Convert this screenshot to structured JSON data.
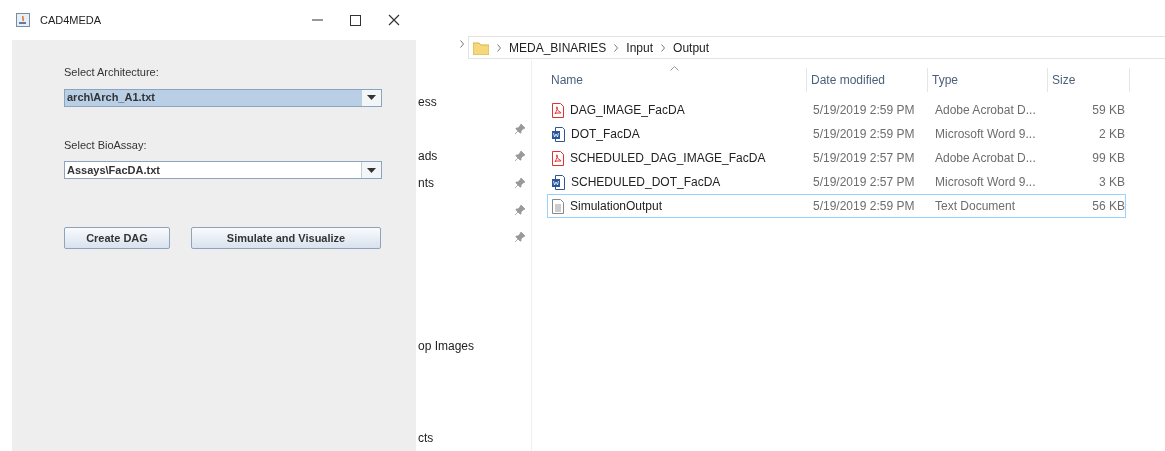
{
  "java_window": {
    "title": "CAD4MEDA",
    "fields": [
      {
        "label": "Select Architecture:",
        "value": "arch\\Arch_A1.txt",
        "focused": true
      },
      {
        "label": "Select BioAssay:",
        "value": "Assays\\FacDA.txt",
        "focused": false
      }
    ],
    "buttons": [
      "Create DAG",
      "Simulate and Visualize"
    ]
  },
  "explorer": {
    "breadcrumb": [
      "MEDA_BINARIES",
      "Input",
      "Output"
    ],
    "nav_items": [
      {
        "label": "ess",
        "pinned": false
      },
      {
        "pinned": true
      },
      {
        "label": "ads",
        "pinned": true
      },
      {
        "label": "nts",
        "pinned": true
      },
      {
        "pinned": true
      },
      {
        "pinned": true
      }
    ],
    "nav_lower": [
      "op Images",
      "cts"
    ],
    "columns": [
      "Name",
      "Date modified",
      "Type",
      "Size"
    ],
    "files": [
      {
        "kind": "pdf",
        "name": "DAG_IMAGE_FacDA",
        "date": "5/19/2019 2:59 PM",
        "type": "Adobe Acrobat D...",
        "size": "59 KB",
        "selected": false
      },
      {
        "kind": "word",
        "name": "DOT_FacDA",
        "date": "5/19/2019 2:59 PM",
        "type": "Microsoft Word 9...",
        "size": "2 KB",
        "selected": false
      },
      {
        "kind": "pdf",
        "name": "SCHEDULED_DAG_IMAGE_FacDA",
        "date": "5/19/2019 2:57 PM",
        "type": "Adobe Acrobat D...",
        "size": "99 KB",
        "selected": false
      },
      {
        "kind": "word",
        "name": "SCHEDULED_DOT_FacDA",
        "date": "5/19/2019 2:57 PM",
        "type": "Microsoft Word 9...",
        "size": "3 KB",
        "selected": false
      },
      {
        "kind": "text",
        "name": "SimulationOutput",
        "date": "5/19/2019 2:59 PM",
        "type": "Text Document",
        "size": "56 KB",
        "selected": true
      }
    ]
  }
}
